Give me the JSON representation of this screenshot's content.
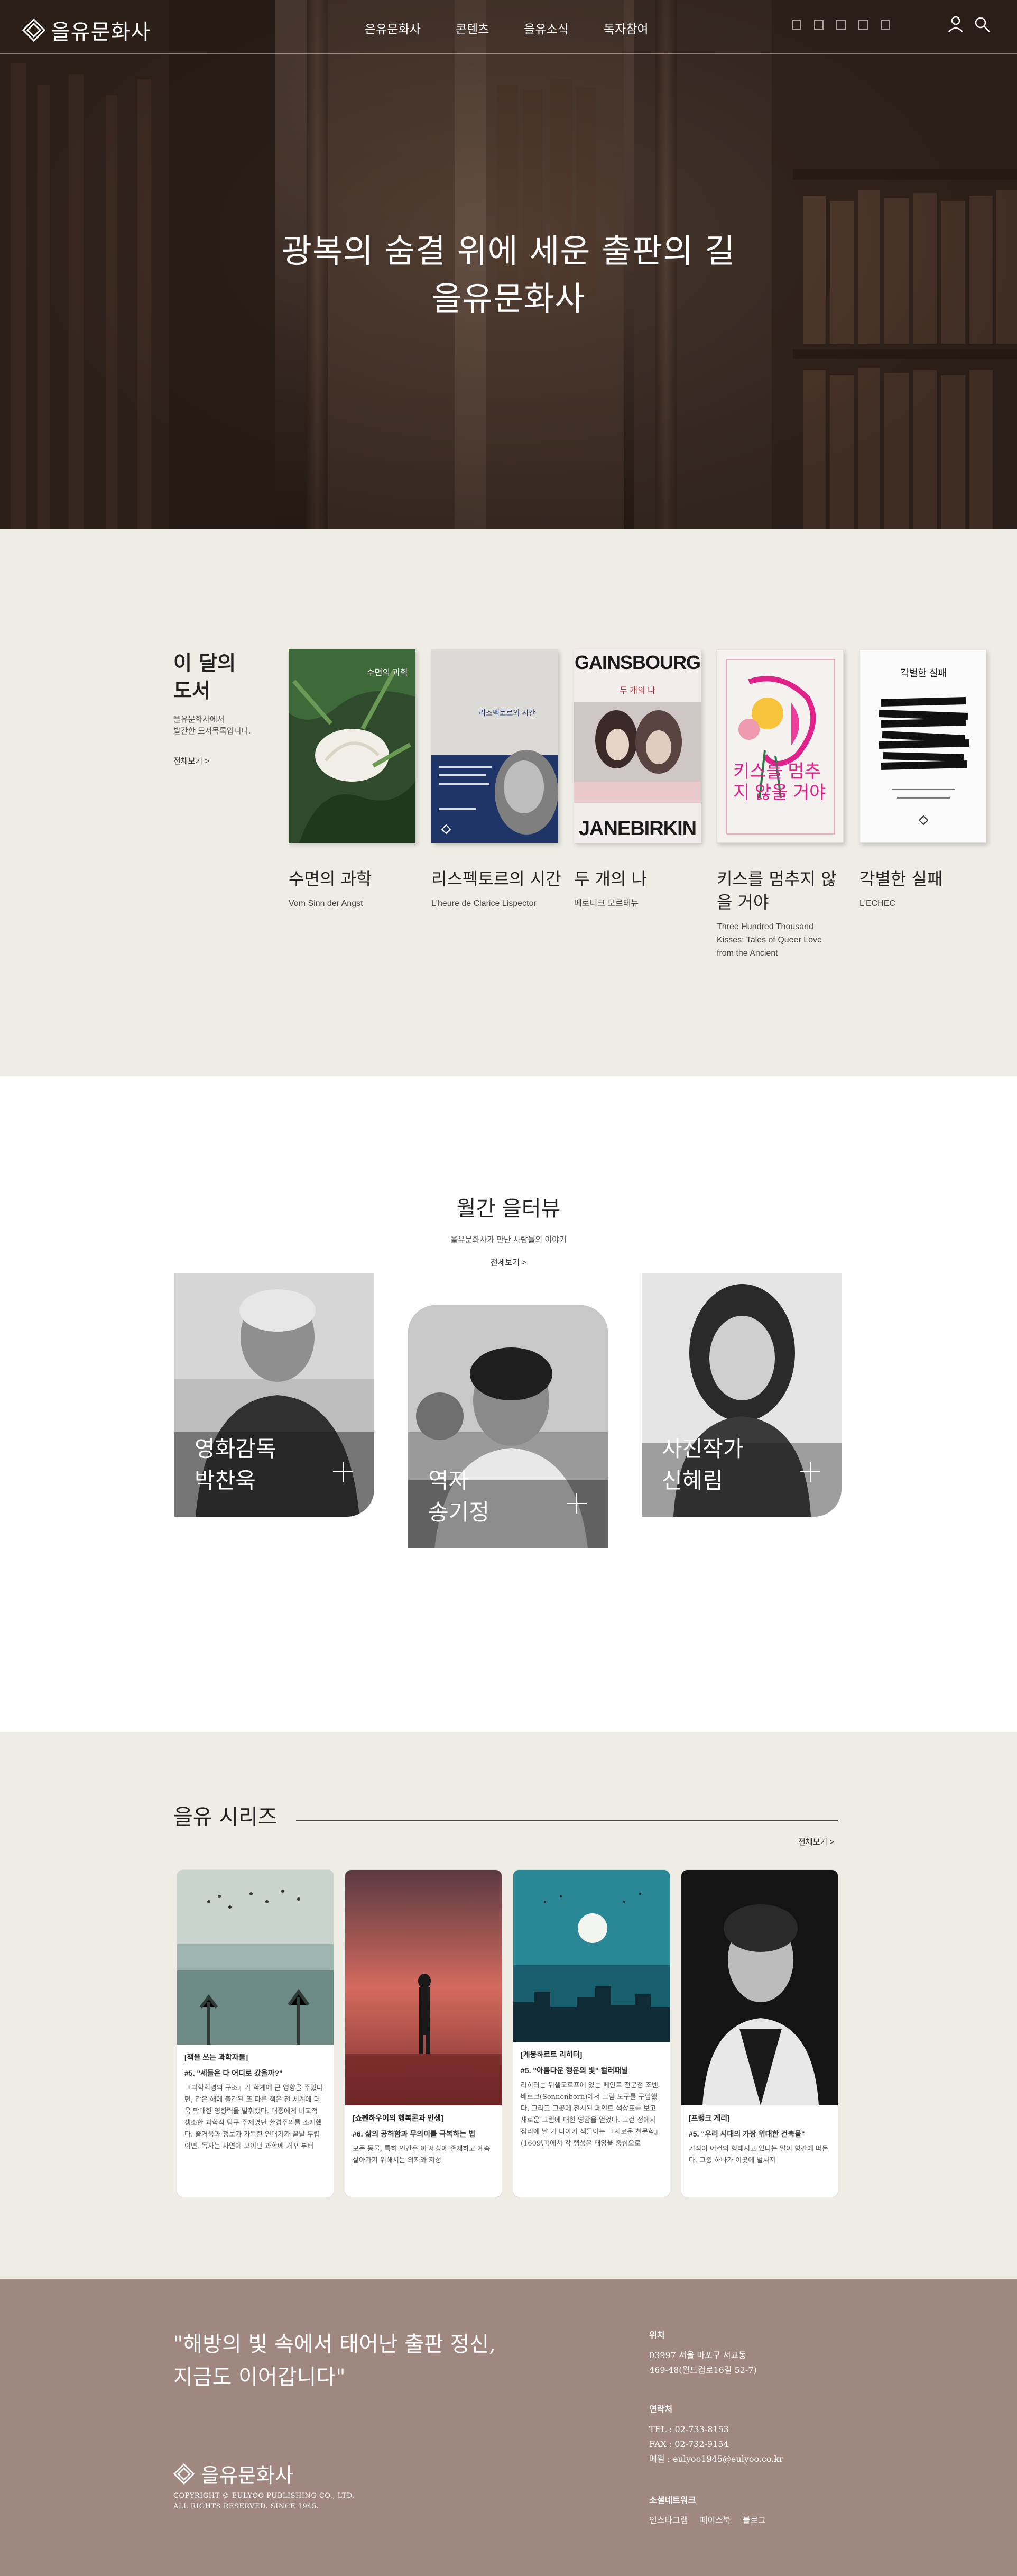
{
  "header": {
    "logo_text": "을유문화사",
    "nav": [
      "은유문화사",
      "콘텐츠",
      "을유소식",
      "독자참여"
    ],
    "icons": [
      "user-icon",
      "search-icon"
    ]
  },
  "hero": {
    "line1": "광복의 숨결 위에 세운 출판의 길",
    "line2": "을유문화사"
  },
  "month_books": {
    "heading_line1": "이 달의",
    "heading_line2": "도서",
    "desc_line1": "을유문화사에서",
    "desc_line2": "발간한 도서목록입니다.",
    "more": "전체보기 >",
    "books": [
      {
        "title": "수면의 과학",
        "subtitle": "Vom Sinn der Angst",
        "cover_text": "수면의 과학"
      },
      {
        "title": "리스펙토르의 시간",
        "subtitle": "L'heure de Clarice Lispector",
        "cover_text": "리스펙토르의 시간"
      },
      {
        "title": "두 개의 나",
        "subtitle": "베로니크 모르테뉴",
        "cover_top": "GAINSBOURG",
        "cover_sub": "두 개의 나",
        "cover_bottom": "JANEBIRKIN"
      },
      {
        "title_line1": "키스를 멈추지 않",
        "title_line2": "을 거야",
        "subtitle_line1": "Three Hundred Thousand",
        "subtitle_line2": "Kisses: Tales of Queer Love",
        "subtitle_line3": "from the Ancient",
        "cover_text": "키스를 멈추지 않을 거야"
      },
      {
        "title": "각별한 실패",
        "subtitle": "L'ECHEC",
        "cover_text": "각별한 실패"
      }
    ]
  },
  "interview": {
    "title": "월간 을터뷰",
    "subtitle": "을유문화사가 만난 사람들의 이야기",
    "more": "전체보기 >",
    "people": [
      {
        "line1": "영화감독",
        "line2": "박찬욱"
      },
      {
        "line1": "역자",
        "line2": "송기정"
      },
      {
        "line1": "사진작가",
        "line2": "신혜림"
      }
    ]
  },
  "series": {
    "title": "을유 시리즈",
    "more": "전체보기 >",
    "cards": [
      {
        "category": "[책을 쓰는 과학자들]",
        "title": "#5. \"세들은 다 어디로 갔을까?\"",
        "text": "『과학혁명의 구조』가 학계에 큰 영향을 주었다면, 같은 해에 출간된 또 다른 책은 전 세계에 더욱 막대한 영향력을 발휘했다. 대중에게 비교적 생소한 과학적 탐구 주제였던 환경주의를 소개했다. 즐거움과 정보가 가득한 연대기가 끝날 무렵이면, 독자는 자연에 보이던 과학에 거꾸 부터"
      },
      {
        "category": "[쇼펜하우어의 행복론과 인생]",
        "title": "#6. 삶의 공허함과 무의미를 극복하는 법",
        "text": "모든 동물, 특히 인간은 이 세상에 존재하고 계속 살아가기 위해서는 의지와 지성"
      },
      {
        "category": "[계몽하르트 리히터]",
        "title": "#5. \"아름다운 행운의 빛\" 컬러패널",
        "text": "리히터는 뒤셀도르프에 있는 페인트 전문점 조넨베르크(Sonnenborn)에서 그림 도구를 구입했다. 그리고 그곳에 전시된 페인트 색상표를 보고 새로운 그림에 대한 영감을 얻었다. 그런 정에서 점리에 날 거 나아가 색들이는 『새로운 천문학』(1609년)에서 각 행성은 태양을 중심으로"
      },
      {
        "category": "[프랭크 게리]",
        "title": "#5. \"우리 시대의 가장 위대한 건축물\"",
        "text": "기적이 어컨의 형태지고 있다는 말이 항간에 떠돈다. 그중 하나가 이곳에 벌쳐지"
      }
    ]
  },
  "footer": {
    "quote_line1": "\"해방의 빛 속에서 태어난 출판 정신,",
    "quote_line2": "지금도 이어갑니다\"",
    "logo_text": "을유문화사",
    "copyright_line1": "COPYRIGHT © EULYOO PUBLISHING CO., LTD.",
    "copyright_line2": "ALL RIGHTS RESERVED. SINCE 1945.",
    "location_label": "위치",
    "address_line1": "03997 서울 마포구 서교동",
    "address_line2": "469-48(월드컵로16길 52-7)",
    "contact_label": "연락처",
    "tel": "TEL : 02-733-8153",
    "fax": "FAX : 02-732-9154",
    "email": "메일 : eulyoo1945@eulyoo.co.kr",
    "social_label": "소셜네트워크",
    "social": [
      "인스타그램",
      "페이스북",
      "블로그"
    ]
  }
}
